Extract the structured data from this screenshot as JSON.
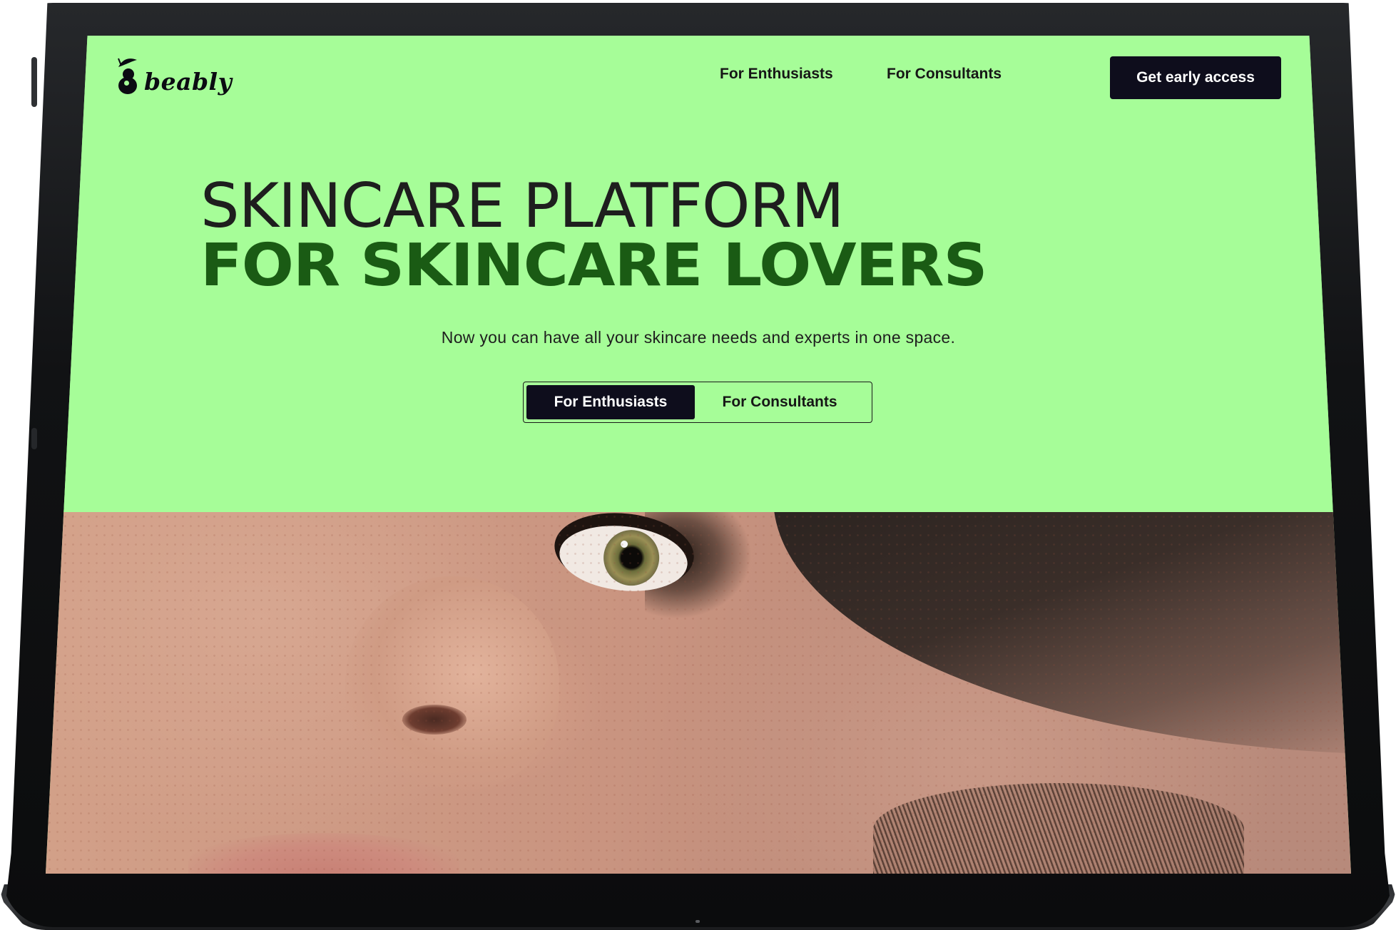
{
  "brand": {
    "name": "beably",
    "logo_icon": "bee-logo-icon"
  },
  "nav": {
    "items": [
      {
        "label": "For Enthusiasts"
      },
      {
        "label": "For Consultants"
      }
    ],
    "cta_label": "Get early access"
  },
  "hero": {
    "headline_line1": "SKINCARE PLATFORM",
    "headline_line2": "FOR SKINCARE LOVERS",
    "subtitle": "Now you can have all your skincare needs and experts in one space.",
    "toggle": {
      "options": [
        {
          "label": "For Enthusiasts",
          "selected": true
        },
        {
          "label": "For Consultants",
          "selected": false
        }
      ]
    }
  },
  "colors": {
    "hero_background": "#a6fd98",
    "headline_accent": "#1a5b14",
    "button_dark": "#0e0d1c",
    "device_frame": "#111214"
  },
  "image": {
    "content": "hero-photo"
  }
}
